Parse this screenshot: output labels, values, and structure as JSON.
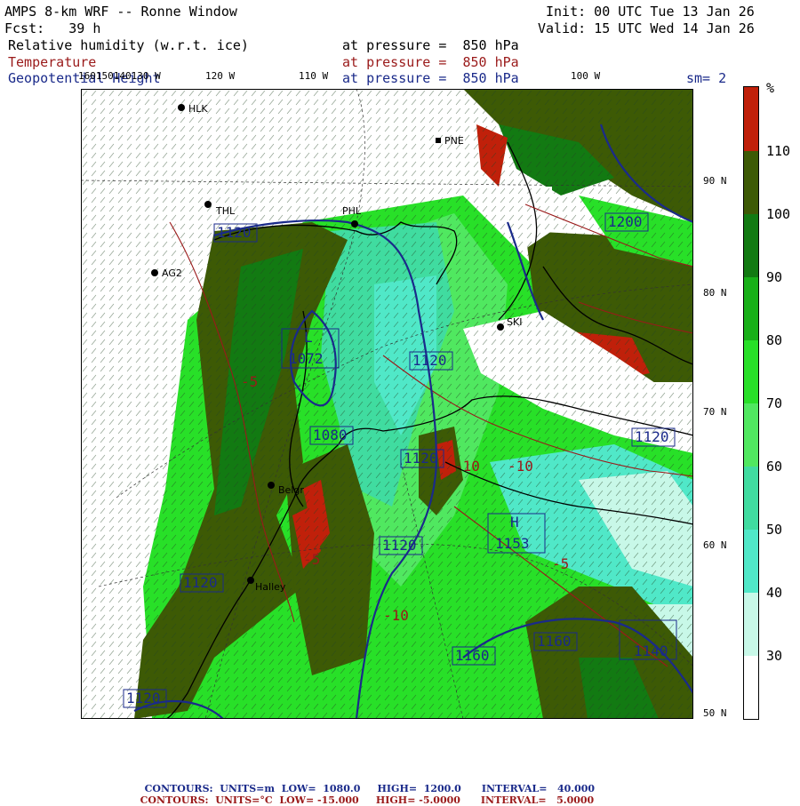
{
  "header": {
    "title": "AMPS 8-km WRF -- Ronne Window",
    "fcst": "Fcst:   39 h",
    "init": "Init: 00 UTC Tue 13 Jan 26",
    "valid": "Valid: 15 UTC Wed 14 Jan 26",
    "fields": [
      {
        "name": "Relative humidity (w.r.t. ice)",
        "level": "at pressure =  850 hPa"
      },
      {
        "name": "Temperature",
        "level": "at pressure =  850 hPa"
      },
      {
        "name": "Geopotential Height",
        "level": "at pressure =  850 hPa"
      }
    ],
    "smoothing": "sm= 2"
  },
  "colors": {
    "temperature": "#9a1a1a",
    "height": "#1a2a8a",
    "rh_110": "#c0200a",
    "rh_100": "#3d5a05",
    "rh_90": "#127a12",
    "rh_80": "#18b018",
    "rh_70": "#28e028",
    "rh_60": "#50e860",
    "rh_50": "#40dca0",
    "rh_40": "#50e8c8",
    "rh_30": "#c8f8e8",
    "rh_low": "#ffffff"
  },
  "colorbar": {
    "unit": "%",
    "labels": [
      "110",
      "100",
      "90",
      "80",
      "70",
      "60",
      "50",
      "40",
      "30"
    ]
  },
  "lon_labels": [
    "160150140130 W",
    "120 W",
    "110 W",
    "100 W"
  ],
  "lat_labels": [
    "90 N",
    "80 N",
    "70 N",
    "60 N",
    "50 N"
  ],
  "stations": [
    "HLK",
    "PNE",
    "THL",
    "PHL",
    "AG2",
    "SKI",
    "Belgr",
    "Halley"
  ],
  "height_labels": [
    "1120",
    "1072",
    "1120",
    "1080",
    "1120",
    "1153",
    "1120",
    "1160",
    "1160",
    "1140",
    "1120",
    "1120",
    "1200",
    "1120"
  ],
  "extrema": [
    "L",
    "H"
  ],
  "temp_labels": [
    "-5",
    "-10",
    "-5",
    "-10",
    "-5",
    "-10"
  ],
  "footer": [
    {
      "label": "CONTOURS:",
      "units": "UNITS=m",
      "low": "LOW=  1080.0",
      "high": "HIGH=  1200.0",
      "interval": "INTERVAL=   40.000"
    },
    {
      "label": "CONTOURS:",
      "units": "UNITS=°C",
      "low": "LOW= -15.000",
      "high": "HIGH= -5.0000",
      "interval": "INTERVAL=   5.0000"
    }
  ]
}
